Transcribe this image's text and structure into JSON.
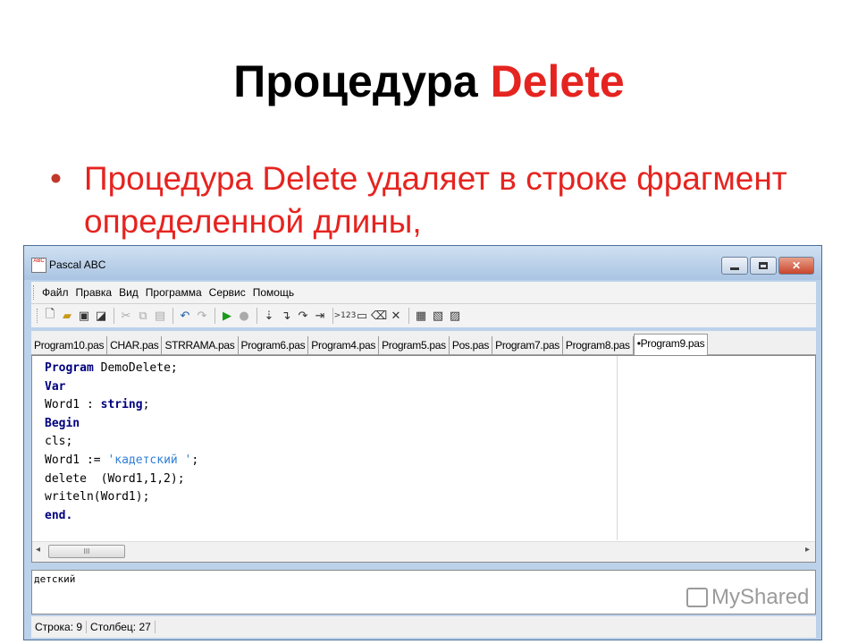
{
  "slide": {
    "title_prefix": "Процедура ",
    "title_accent": "Delete",
    "bullet": "Процедура Delete удаляет в строке фрагмент определенной длины,"
  },
  "window": {
    "app_icon_text": "ABC",
    "title": "Pascal ABC",
    "menu": [
      "Файл",
      "Правка",
      "Вид",
      "Программа",
      "Сервис",
      "Помощь"
    ],
    "tabs": [
      "Program10.pas",
      "CHAR.pas",
      "STRRAMA.pas",
      "Program6.pas",
      "Program4.pas",
      "Program5.pas",
      "Pos.pas",
      "Program7.pas",
      "Program8.pas",
      "•Program9.pas"
    ],
    "active_tab_index": 9,
    "code": {
      "line1_kw": "Program",
      "line1_rest": " DemoDelete;",
      "line2_kw": "Var",
      "line3_pre": "Word1 : ",
      "line3_kw": "string",
      "line3_post": ";",
      "line4_kw": "Begin",
      "line5": "cls;",
      "line6_pre": "Word1 := ",
      "line6_str": "'кадетский '",
      "line6_post": ";",
      "line7": "delete  (Word1,1,2);",
      "line8": "writeln(Word1);",
      "line9_kw": "end."
    },
    "output_text": "детский",
    "status": {
      "row": "Строка: 9",
      "col": "Столбец: 27"
    },
    "scroll_thumb_grip": "III"
  },
  "watermark": "MyShared",
  "icons": [
    "new-file-icon",
    "open-folder-icon",
    "save-icon",
    "save-all-icon",
    "cut-icon",
    "copy-icon",
    "paste-icon",
    "undo-icon",
    "redo-icon",
    "run-icon",
    "stop-icon",
    "step-icon",
    "step-into-icon",
    "step-over-icon",
    "run-to-cursor-icon",
    "evaluate-icon",
    "watch-icon",
    "clear-icon",
    "close-icon",
    "format-icon",
    "debug-icon",
    "compile-icon"
  ]
}
